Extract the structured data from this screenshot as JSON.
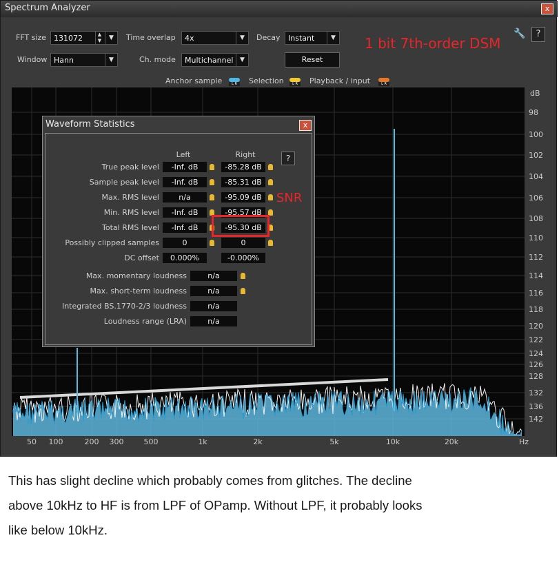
{
  "window": {
    "title": "Spectrum Analyzer",
    "close": "x"
  },
  "controls": {
    "fft_size_label": "FFT size",
    "fft_size_value": "131072",
    "time_overlap_label": "Time overlap",
    "time_overlap_value": "4x",
    "decay_label": "Decay",
    "decay_value": "Instant",
    "window_label": "Window",
    "window_value": "Hann",
    "ch_mode_label": "Ch. mode",
    "ch_mode_value": "Multichannel",
    "reset_label": "Reset",
    "help": "?"
  },
  "legend": {
    "anchor_label": "Anchor sample",
    "selection_label": "Selection",
    "playback_label": "Playback / input",
    "anchor_color": "#4fb8e8",
    "selection_color": "#f0c830",
    "playback_color": "#e87828",
    "lr": "L R"
  },
  "annotation": {
    "text": "1 bit  7th-order DSM",
    "snr": "SNR"
  },
  "y_axis": {
    "unit": "dB",
    "ticks": [
      "98",
      "100",
      "102",
      "104",
      "106",
      "108",
      "110",
      "112",
      "114",
      "116",
      "118",
      "120",
      "122",
      "124",
      "126",
      "128",
      "132",
      "136",
      "142"
    ]
  },
  "x_axis": {
    "unit": "Hz",
    "ticks": [
      "50",
      "100",
      "200",
      "300",
      "500",
      "1k",
      "2k",
      "5k",
      "10k",
      "20k"
    ]
  },
  "stats": {
    "title": "Waveform Statistics",
    "close": "x",
    "help": "?",
    "col_left": "Left",
    "col_right": "Right",
    "rows": [
      {
        "label": "True peak level",
        "left": "-Inf. dB",
        "right": "-85.28 dB"
      },
      {
        "label": "Sample peak level",
        "left": "-Inf. dB",
        "right": "-85.31 dB"
      },
      {
        "label": "Max. RMS level",
        "left": "n/a",
        "right": "-95.09 dB"
      },
      {
        "label": "Min. RMS level",
        "left": "-Inf. dB",
        "right": "-95.57 dB"
      },
      {
        "label": "Total RMS level",
        "left": "-Inf. dB",
        "right": "-95.30 dB"
      },
      {
        "label": "Possibly clipped samples",
        "left": "0",
        "right": "0"
      },
      {
        "label": "DC offset",
        "left": "0.000%",
        "right": "-0.000%"
      }
    ],
    "loudness": [
      {
        "label": "Max. momentary loudness",
        "value": "n/a"
      },
      {
        "label": "Max. short-term loudness",
        "value": "n/a"
      },
      {
        "label": "Integrated BS.1770-2/3 loudness",
        "value": "n/a"
      },
      {
        "label": "Loudness range (LRA)",
        "value": "n/a"
      }
    ]
  },
  "caption": [
    "This has slight decline which probably comes from glitches.  The decline",
    "above 10kHz to HF is from LPF of OPamp. Without LPF, it probably looks",
    "like below 10kHz."
  ]
}
